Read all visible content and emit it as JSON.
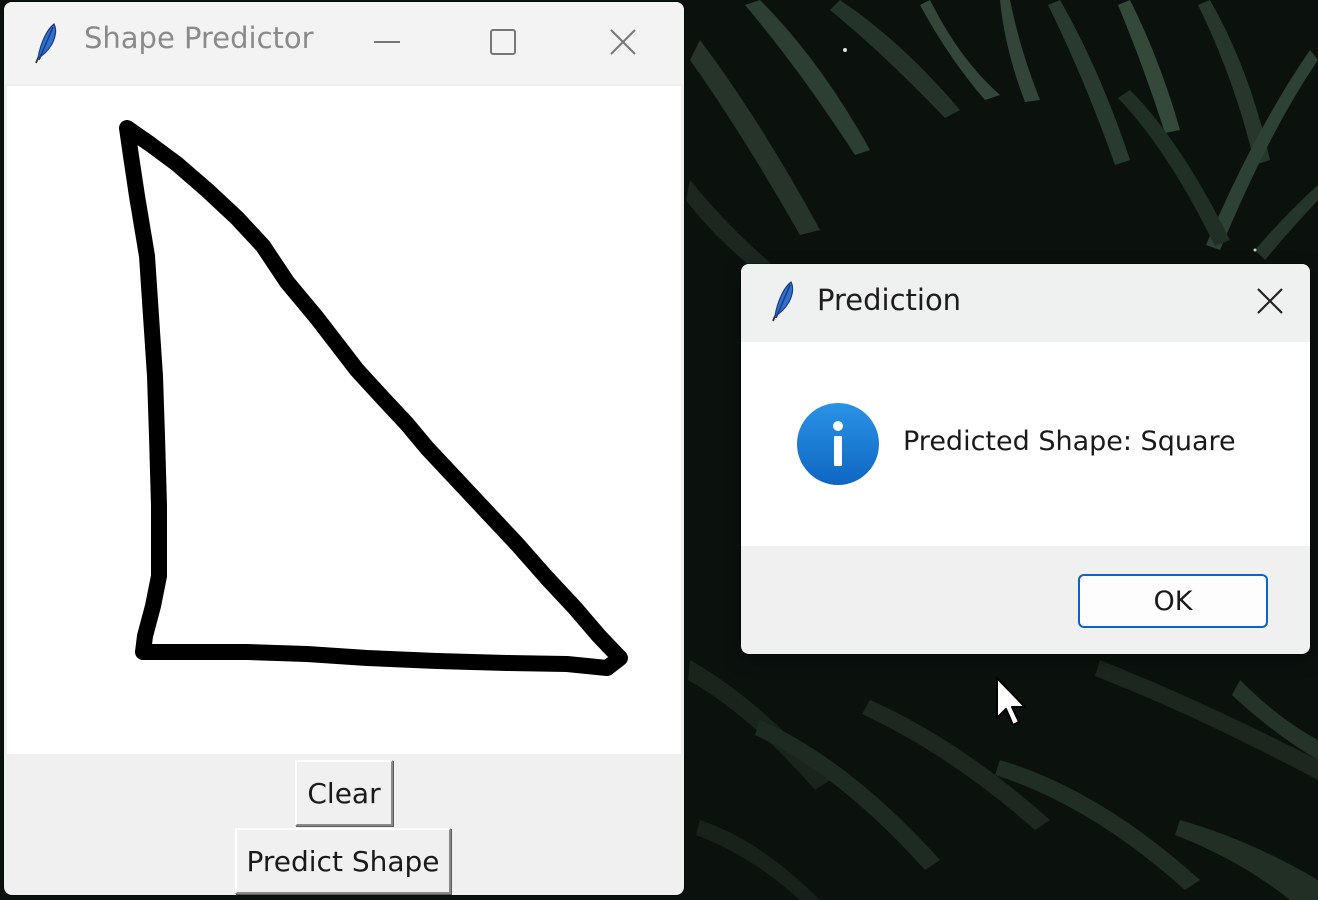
{
  "main_window": {
    "title": "Shape Predictor",
    "controls": [
      "minimize",
      "maximize",
      "close"
    ],
    "buttons": {
      "clear_label": "Clear",
      "predict_label": "Predict Shape"
    }
  },
  "dialog": {
    "title": "Prediction",
    "message": "Predicted Shape: Square",
    "ok_label": "OK",
    "icon": "info-icon"
  },
  "icons": {
    "app_icon": "feather-icon",
    "info": "info-icon"
  },
  "colors": {
    "accent": "#0a64c8",
    "info_icon": "#1a7fd6",
    "stroke": "#000000"
  }
}
